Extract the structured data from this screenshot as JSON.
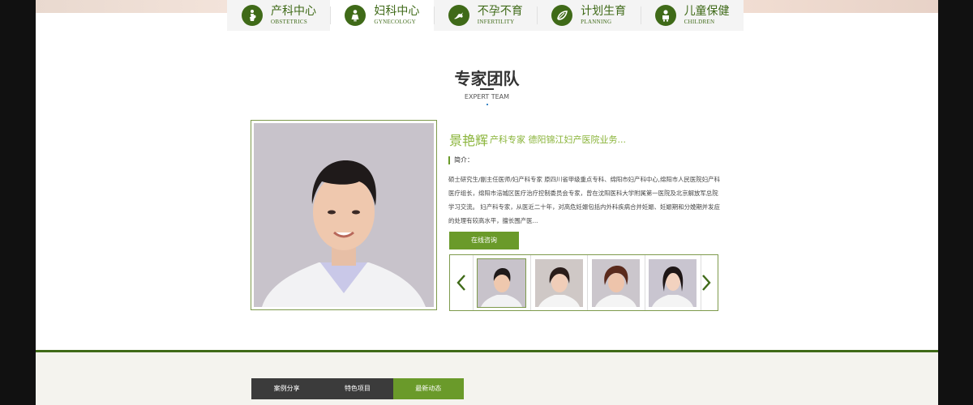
{
  "dept_nav": [
    {
      "cn": "产科中心",
      "en": "OBSTETRICS",
      "icon": "pregnant-woman-icon"
    },
    {
      "cn": "妇科中心",
      "en": "GYNECOLOGY",
      "icon": "woman-icon",
      "active": true
    },
    {
      "cn": "不孕不育",
      "en": "INFERTILITY",
      "icon": "fertility-icon"
    },
    {
      "cn": "计划生育",
      "en": "PLANNING",
      "icon": "hand-leaf-icon"
    },
    {
      "cn": "儿童保健",
      "en": "CHILDREN",
      "icon": "baby-icon"
    }
  ],
  "section": {
    "title": "专家团队",
    "subtitle": "EXPERT TEAM"
  },
  "doctor": {
    "name": "景艳辉",
    "title": "产科专家 德阳锦江妇产医院业务...",
    "intro_label": "简介：",
    "bio": "硕士研究生/副主任医师/妇产科专家 原四川省甲级重点专科、绵阳市妇产科中心,绵阳市人民医院妇产科医疗组长，绵阳市涪城区医疗治疗控制委员会专家，曾在沈阳医科大学附属第一医院及北京解放军总院学习交流。 妇产科专家，从医近二十年，对高危妊娠包括内外科疾病合并妊娠、妊娠期和分娩期并发症的处理有较高水平，擅长围产医...",
    "consult_label": "在线咨询"
  },
  "carousel": {
    "prev_icon": "chevron-left-icon",
    "next_icon": "chevron-right-icon",
    "thumbs": [
      {
        "kind": "man-short-hair",
        "active": true
      },
      {
        "kind": "woman-short-hair"
      },
      {
        "kind": "woman-curly-hair"
      },
      {
        "kind": "woman-long-hair"
      }
    ]
  },
  "bottom_tabs": [
    {
      "label": "案例分享"
    },
    {
      "label": "特色项目"
    },
    {
      "label": "最新动态",
      "active": true
    }
  ],
  "colors": {
    "brand_green": "#3f6a18",
    "accent_green": "#6a9a2a",
    "light_green": "#8ab43a",
    "dark_tab": "#3b3b3b"
  }
}
